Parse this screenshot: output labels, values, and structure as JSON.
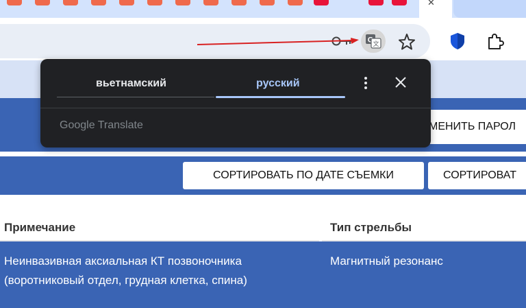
{
  "browser": {
    "tab_icons": [
      "favicon-icon",
      "favicon-icon",
      "favicon-icon",
      "favicon-icon",
      "favicon-icon",
      "favicon-icon",
      "favicon-icon",
      "favicon-icon",
      "favicon-icon",
      "favicon-icon",
      "favicon-icon",
      "favicon-icon",
      "favicon-icon",
      "favicon-icon"
    ],
    "toolbar_icons": [
      "key-icon",
      "translate-icon",
      "star-icon",
      "shield-icon",
      "puzzle-icon"
    ],
    "accent_color": "#ea4335"
  },
  "translate_popup": {
    "source_language": "вьетнамский",
    "target_language": "русский",
    "brand": "Google Translate"
  },
  "page": {
    "change_password_label": "МЕНИТЬ ПАРОЛ",
    "sort_by_date_label": "СОРТИРОВАТЬ ПО ДАТЕ СЪЕМКИ",
    "sort_other_label": "СОРТИРОВАТ",
    "table": {
      "columns": [
        "Примечание",
        "Тип стрельбы"
      ],
      "rows": [
        {
          "note": "Неинвазивная аксиальная КТ позвоночника (воротниковый отдел, грудная клетка, спина)",
          "type": "Магнитный резонанс"
        }
      ]
    }
  }
}
